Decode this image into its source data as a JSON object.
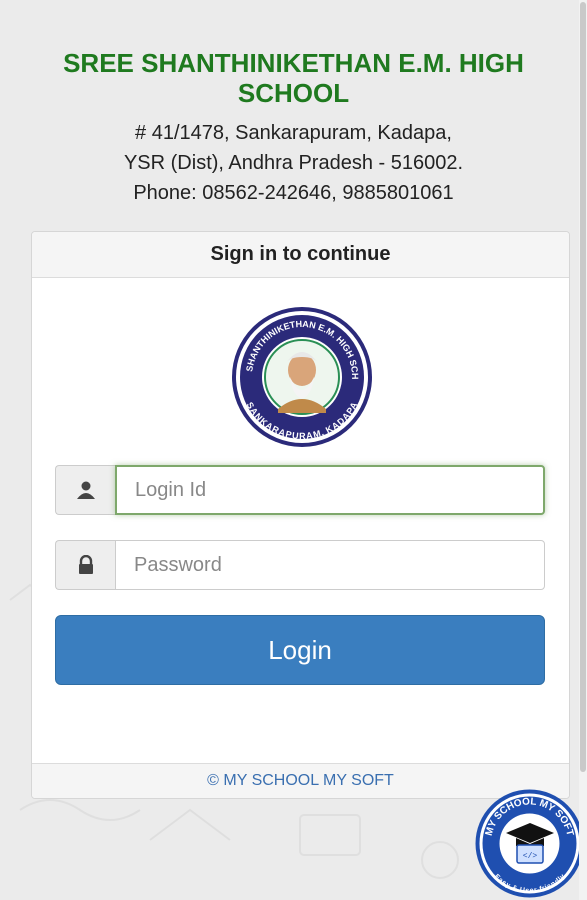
{
  "header": {
    "school_name": "SREE SHANTHINIKETHAN E.M. HIGH SCHOOL",
    "address_line1": "# 41/1478, Sankarapuram, Kadapa,",
    "address_line2": "YSR (Dist), Andhra Pradesh - 516002.",
    "phone": "Phone: 08562-242646, 9885801061"
  },
  "panel": {
    "heading": "Sign in to continue",
    "logo": {
      "top_text": "SREE SHANTHINIKETHAN E.M. HIGH SCHOOL",
      "bottom_text": "SANKARAPURAM, KADAPA"
    },
    "login_id": {
      "placeholder": "Login Id",
      "value": "",
      "icon": "user-icon"
    },
    "password": {
      "placeholder": "Password",
      "value": "",
      "icon": "lock-icon"
    },
    "login_button": "Login",
    "footer": "© MY SCHOOL MY SOFT"
  },
  "badge": {
    "top_text": "MY SCHOOL MY SOFT",
    "bottom_text": "Easy & User-friendly"
  },
  "colors": {
    "title_green": "#1f7a1f",
    "button_blue": "#3a7ebf",
    "footer_link": "#3a6fb0",
    "badge_blue": "#1f4fb0"
  }
}
